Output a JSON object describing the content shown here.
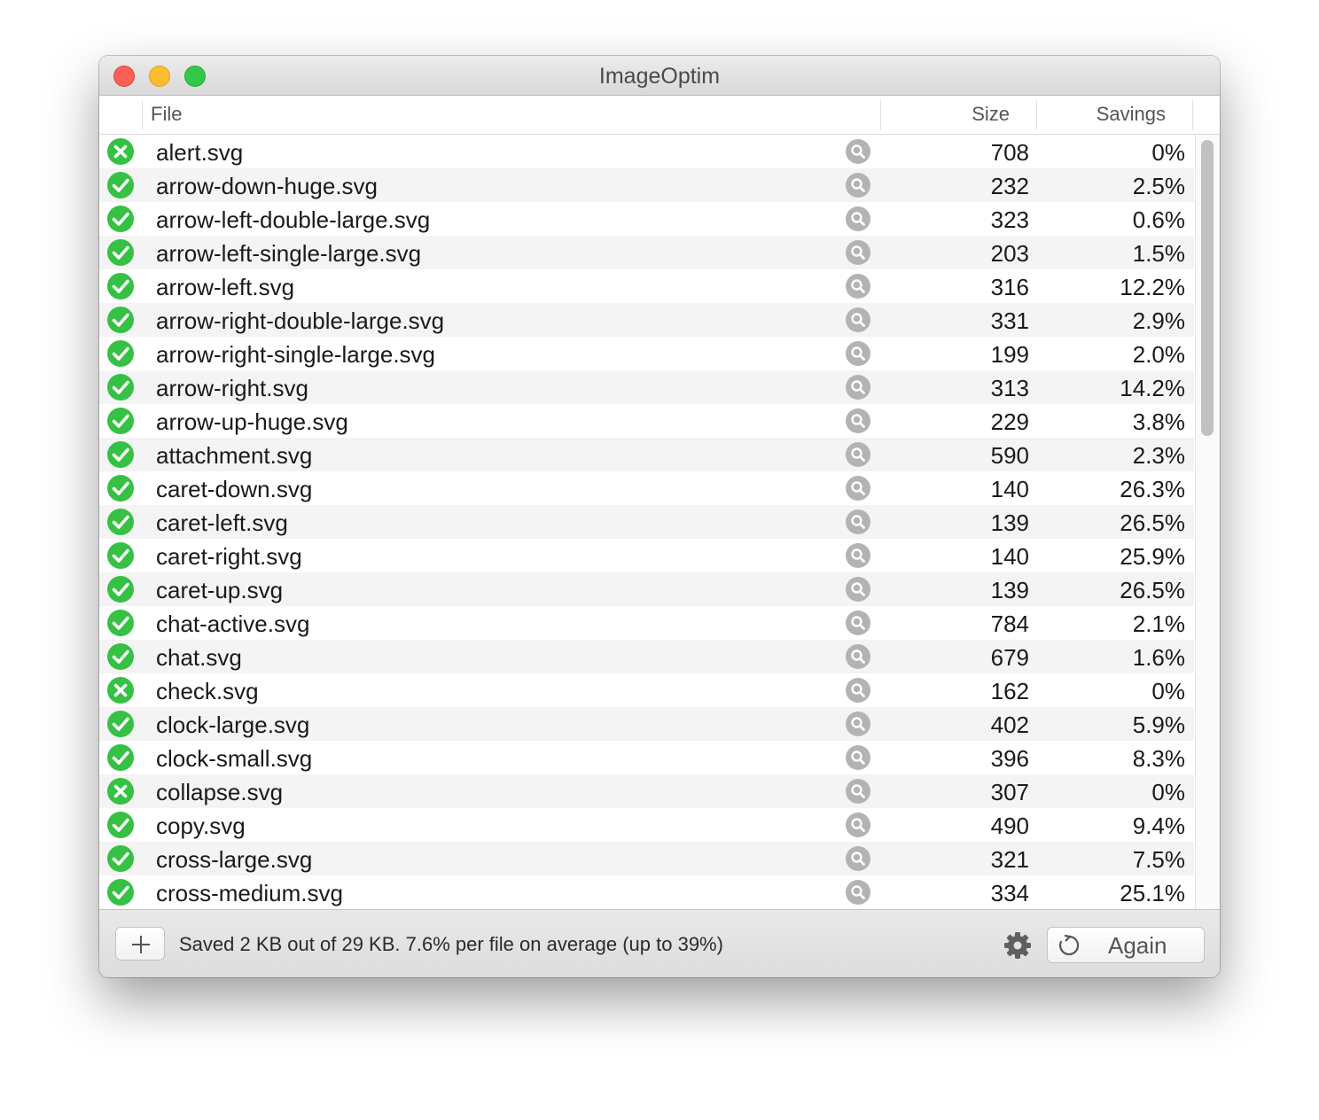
{
  "window": {
    "title": "ImageOptim"
  },
  "columns": {
    "file": "File",
    "size": "Size",
    "savings": "Savings"
  },
  "files": [
    {
      "name": "alert.svg",
      "status": "failed",
      "size": "708",
      "savings": "0%"
    },
    {
      "name": "arrow-down-huge.svg",
      "status": "ok",
      "size": "232",
      "savings": "2.5%"
    },
    {
      "name": "arrow-left-double-large.svg",
      "status": "ok",
      "size": "323",
      "savings": "0.6%"
    },
    {
      "name": "arrow-left-single-large.svg",
      "status": "ok",
      "size": "203",
      "savings": "1.5%"
    },
    {
      "name": "arrow-left.svg",
      "status": "ok",
      "size": "316",
      "savings": "12.2%"
    },
    {
      "name": "arrow-right-double-large.svg",
      "status": "ok",
      "size": "331",
      "savings": "2.9%"
    },
    {
      "name": "arrow-right-single-large.svg",
      "status": "ok",
      "size": "199",
      "savings": "2.0%"
    },
    {
      "name": "arrow-right.svg",
      "status": "ok",
      "size": "313",
      "savings": "14.2%"
    },
    {
      "name": "arrow-up-huge.svg",
      "status": "ok",
      "size": "229",
      "savings": "3.8%"
    },
    {
      "name": "attachment.svg",
      "status": "ok",
      "size": "590",
      "savings": "2.3%"
    },
    {
      "name": "caret-down.svg",
      "status": "ok",
      "size": "140",
      "savings": "26.3%"
    },
    {
      "name": "caret-left.svg",
      "status": "ok",
      "size": "139",
      "savings": "26.5%"
    },
    {
      "name": "caret-right.svg",
      "status": "ok",
      "size": "140",
      "savings": "25.9%"
    },
    {
      "name": "caret-up.svg",
      "status": "ok",
      "size": "139",
      "savings": "26.5%"
    },
    {
      "name": "chat-active.svg",
      "status": "ok",
      "size": "784",
      "savings": "2.1%"
    },
    {
      "name": "chat.svg",
      "status": "ok",
      "size": "679",
      "savings": "1.6%"
    },
    {
      "name": "check.svg",
      "status": "failed",
      "size": "162",
      "savings": "0%"
    },
    {
      "name": "clock-large.svg",
      "status": "ok",
      "size": "402",
      "savings": "5.9%"
    },
    {
      "name": "clock-small.svg",
      "status": "ok",
      "size": "396",
      "savings": "8.3%"
    },
    {
      "name": "collapse.svg",
      "status": "failed",
      "size": "307",
      "savings": "0%"
    },
    {
      "name": "copy.svg",
      "status": "ok",
      "size": "490",
      "savings": "9.4%"
    },
    {
      "name": "cross-large.svg",
      "status": "ok",
      "size": "321",
      "savings": "7.5%"
    },
    {
      "name": "cross-medium.svg",
      "status": "ok",
      "size": "334",
      "savings": "25.1%"
    }
  ],
  "footer": {
    "status_text": "Saved 2 KB out of 29 KB. 7.6% per file on average (up to 39%)",
    "again_label": "Again"
  },
  "icons": {
    "status_ok": "check-circle-icon",
    "status_failed": "x-circle-icon",
    "row_action": "magnifier-icon",
    "add": "plus-icon",
    "settings": "gear-icon",
    "again": "refresh-icon"
  },
  "colors": {
    "success_green": "#35c144",
    "close": "#fc5f57",
    "minimize": "#fdbc2e",
    "maximize": "#34c84a"
  }
}
